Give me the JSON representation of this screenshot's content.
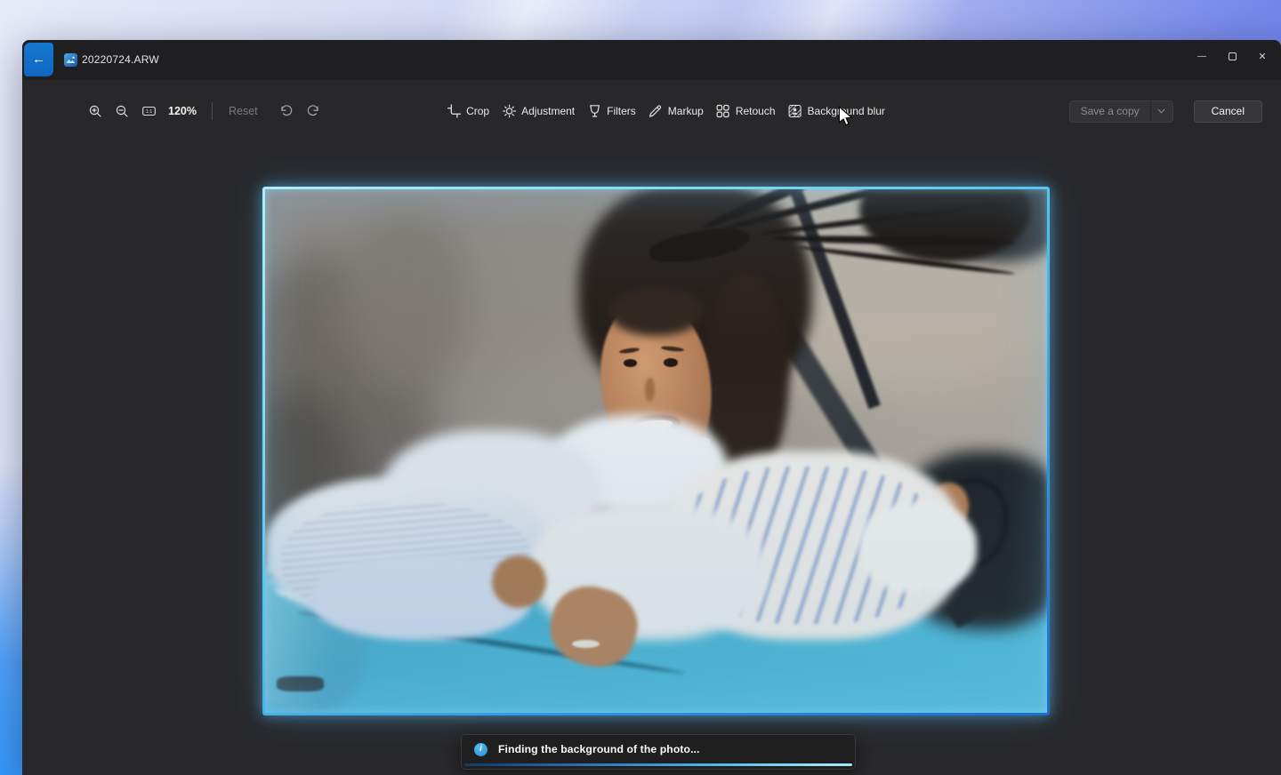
{
  "window": {
    "filename": "20220724.ARW",
    "controls": {
      "minimize": "—",
      "close": "✕"
    }
  },
  "toolbar": {
    "zoom_level": "120%",
    "reset": "Reset",
    "tools": [
      {
        "id": "crop",
        "label": "Crop"
      },
      {
        "id": "adjustment",
        "label": "Adjustment"
      },
      {
        "id": "filters",
        "label": "Filters"
      },
      {
        "id": "markup",
        "label": "Markup"
      },
      {
        "id": "retouch",
        "label": "Retouch"
      },
      {
        "id": "background-blur",
        "label": "Background blur"
      }
    ],
    "save": "Save a copy",
    "cancel": "Cancel"
  },
  "toast": {
    "info_glyph": "i",
    "message": "Finding the background of the photo..."
  },
  "icons": {
    "back": "←",
    "app": "photos-app-icon",
    "zoom_in": "magnifier-plus",
    "zoom_out": "magnifier-minus",
    "fit": "1:1",
    "undo": "undo-arrow",
    "redo": "redo-arrow",
    "chevron_down": "⌄",
    "maximize": "▢",
    "info": "info-circle"
  },
  "colors": {
    "accent_blue": "#0f6cc4",
    "border_glow": "#7fd9f3",
    "car_teal": "#4bb2d2",
    "toast_info": "#3aa5e0",
    "window_bg": "#28282a"
  }
}
